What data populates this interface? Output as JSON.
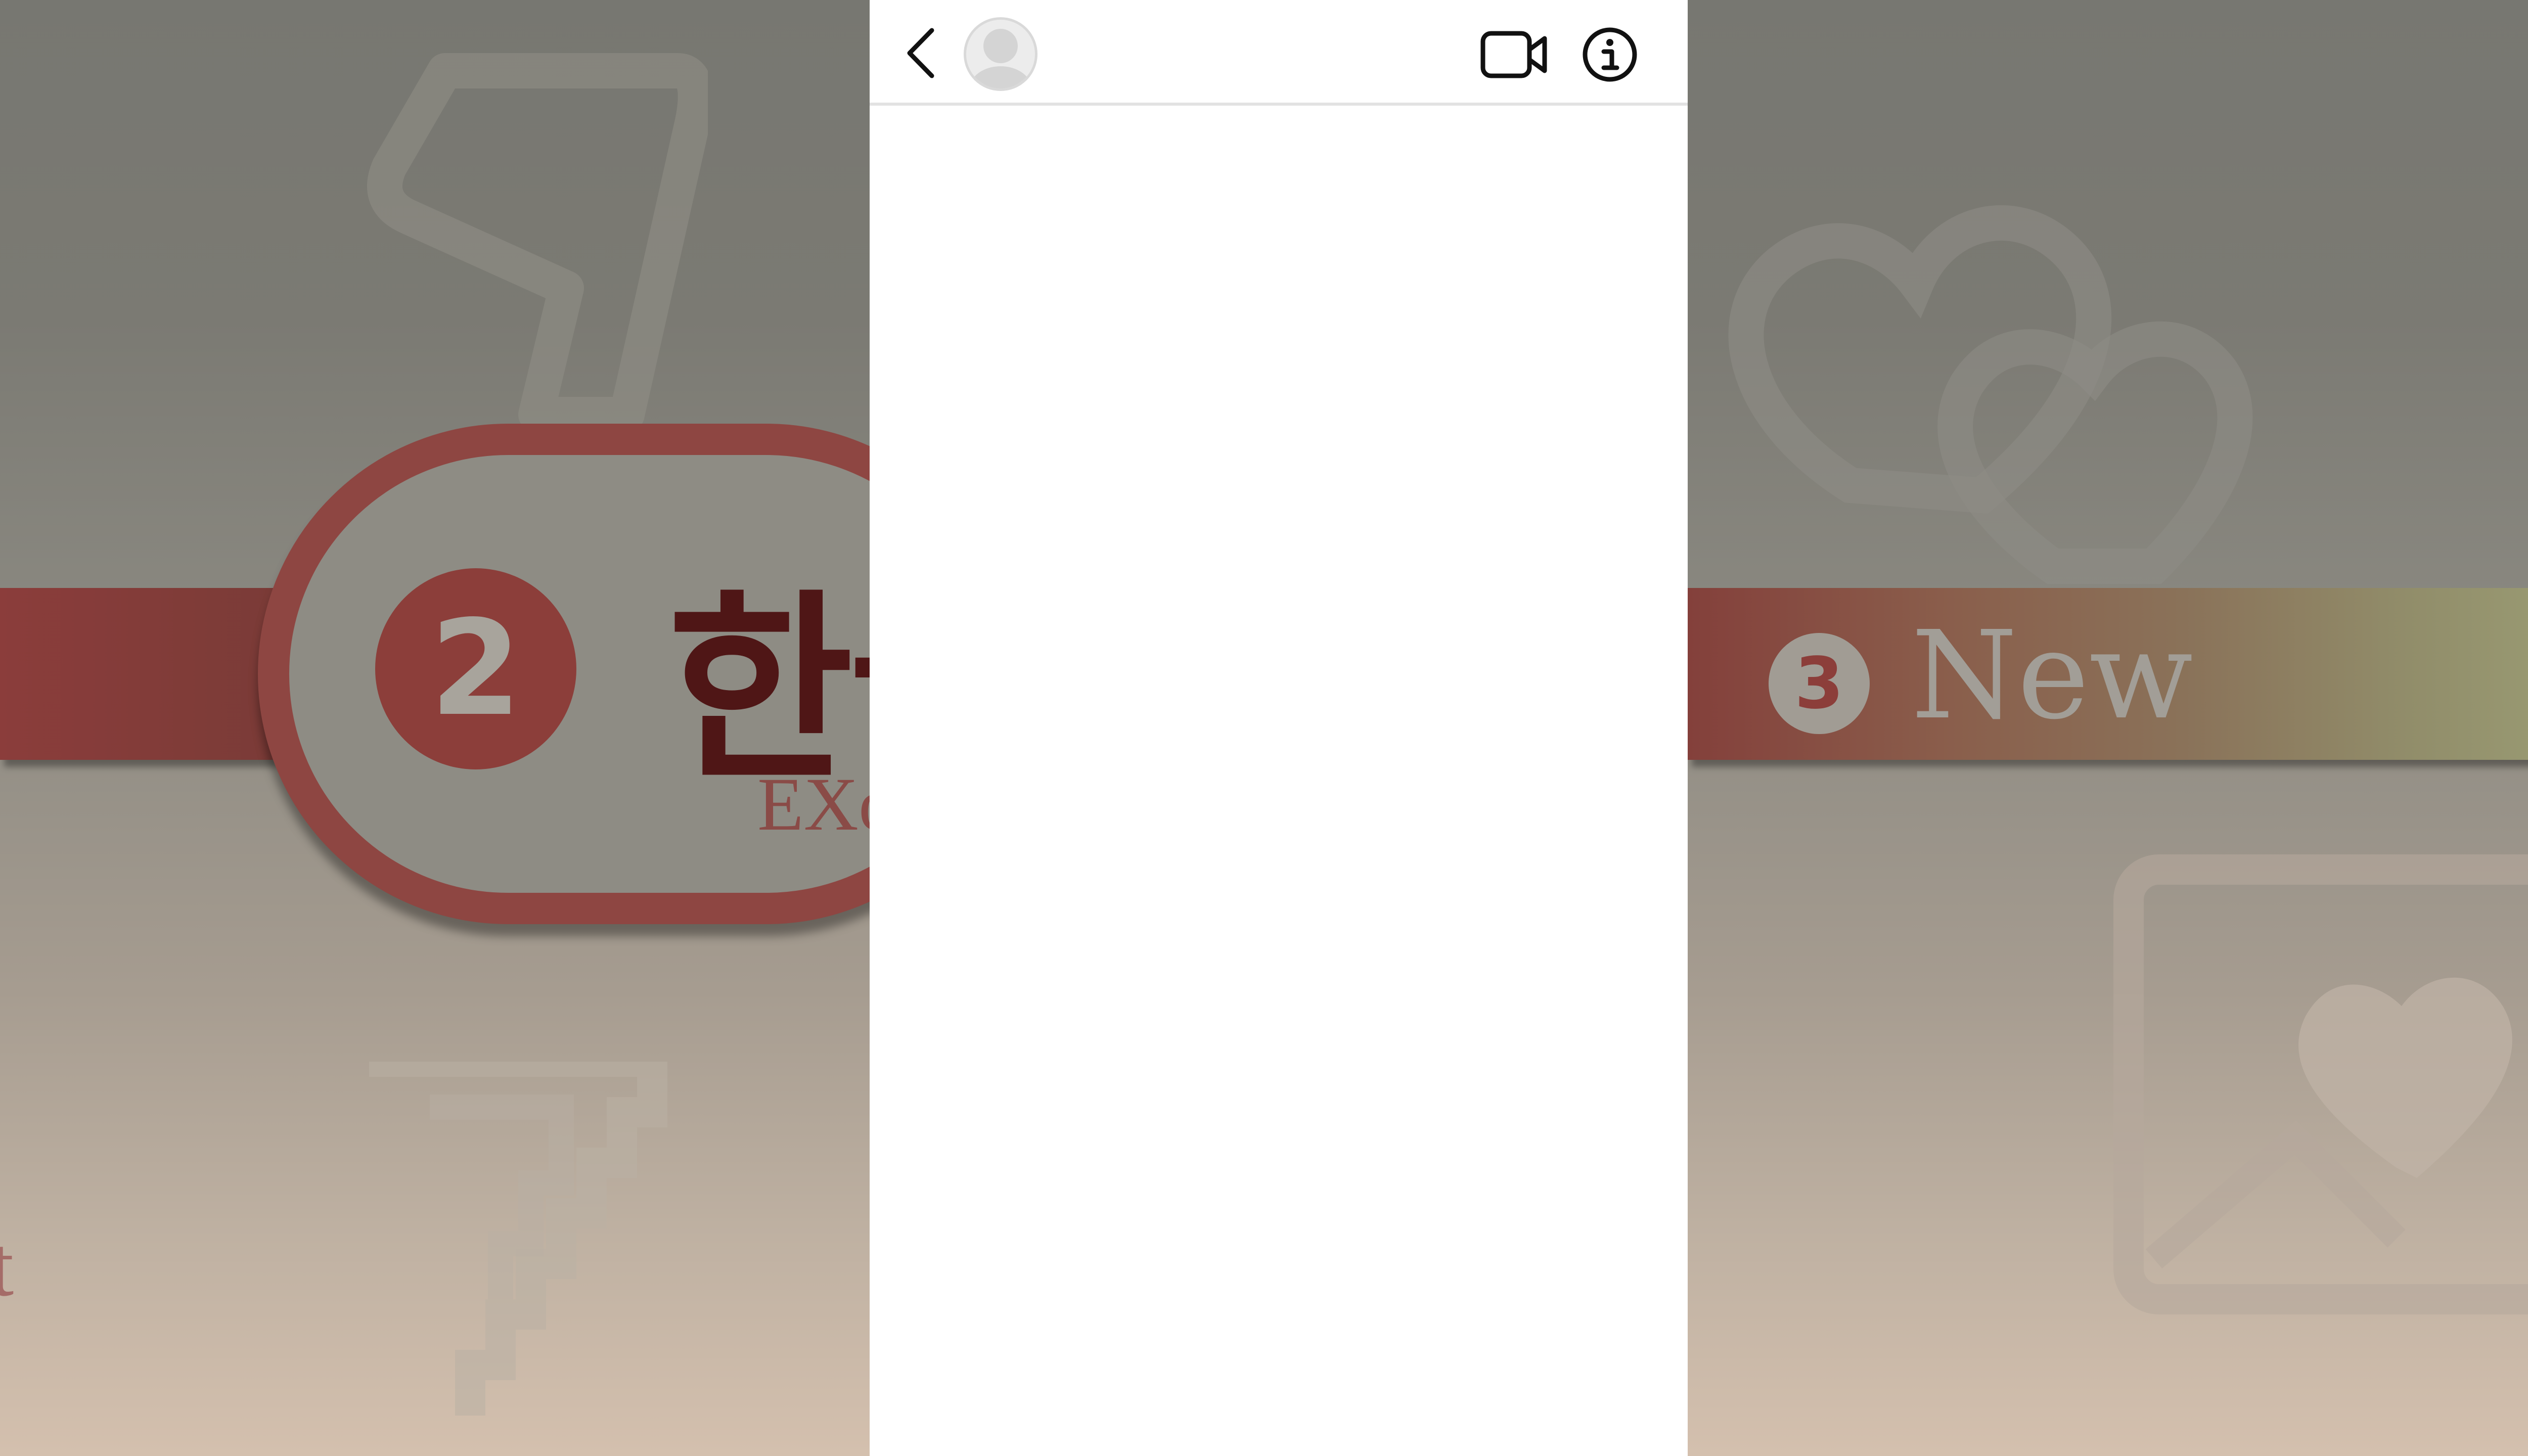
{
  "background": {
    "left_pill_badge": "2",
    "left_pill_title": "한글",
    "left_pill_subtitle": "EXo",
    "left_edge_fragment": "t",
    "right_band_badge": "3",
    "right_band_text": "New",
    "colors": {
      "band_red": "#8b3d3b",
      "band_olive": "#9b9d74",
      "title_dark": "#4f1616"
    }
  },
  "panel": {
    "header": {
      "back_icon": "chevron-left-icon",
      "avatar_icon": "default-user-avatar",
      "video_icon": "video-camera-icon",
      "info_icon": "info-circle-icon"
    }
  }
}
